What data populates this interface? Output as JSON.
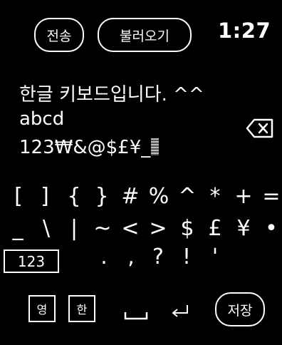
{
  "header": {
    "send_label": "전송",
    "load_label": "불러오기",
    "clock": "1:27"
  },
  "text_area": {
    "lines": [
      "한글 키보드입니다. ^^",
      "abcd",
      "123₩&@$£¥_"
    ]
  },
  "keyboard": {
    "row1": [
      "[",
      "]",
      "{",
      "}",
      "#",
      "%",
      "^",
      "*",
      "+",
      "="
    ],
    "row2": [
      "_",
      "\\",
      "|",
      "~",
      "<",
      ">",
      "$",
      "£",
      "¥",
      "•"
    ],
    "row3": [
      ".",
      ",",
      "?",
      "!",
      "'"
    ],
    "mode_label": "123",
    "eng_label": "영",
    "kor_label": "한",
    "save_label": "저장"
  },
  "icons": {
    "backspace": "backspace-icon",
    "space": "space-icon",
    "enter": "enter-icon"
  },
  "colors": {
    "background": "#000000",
    "foreground": "#ffffff"
  }
}
